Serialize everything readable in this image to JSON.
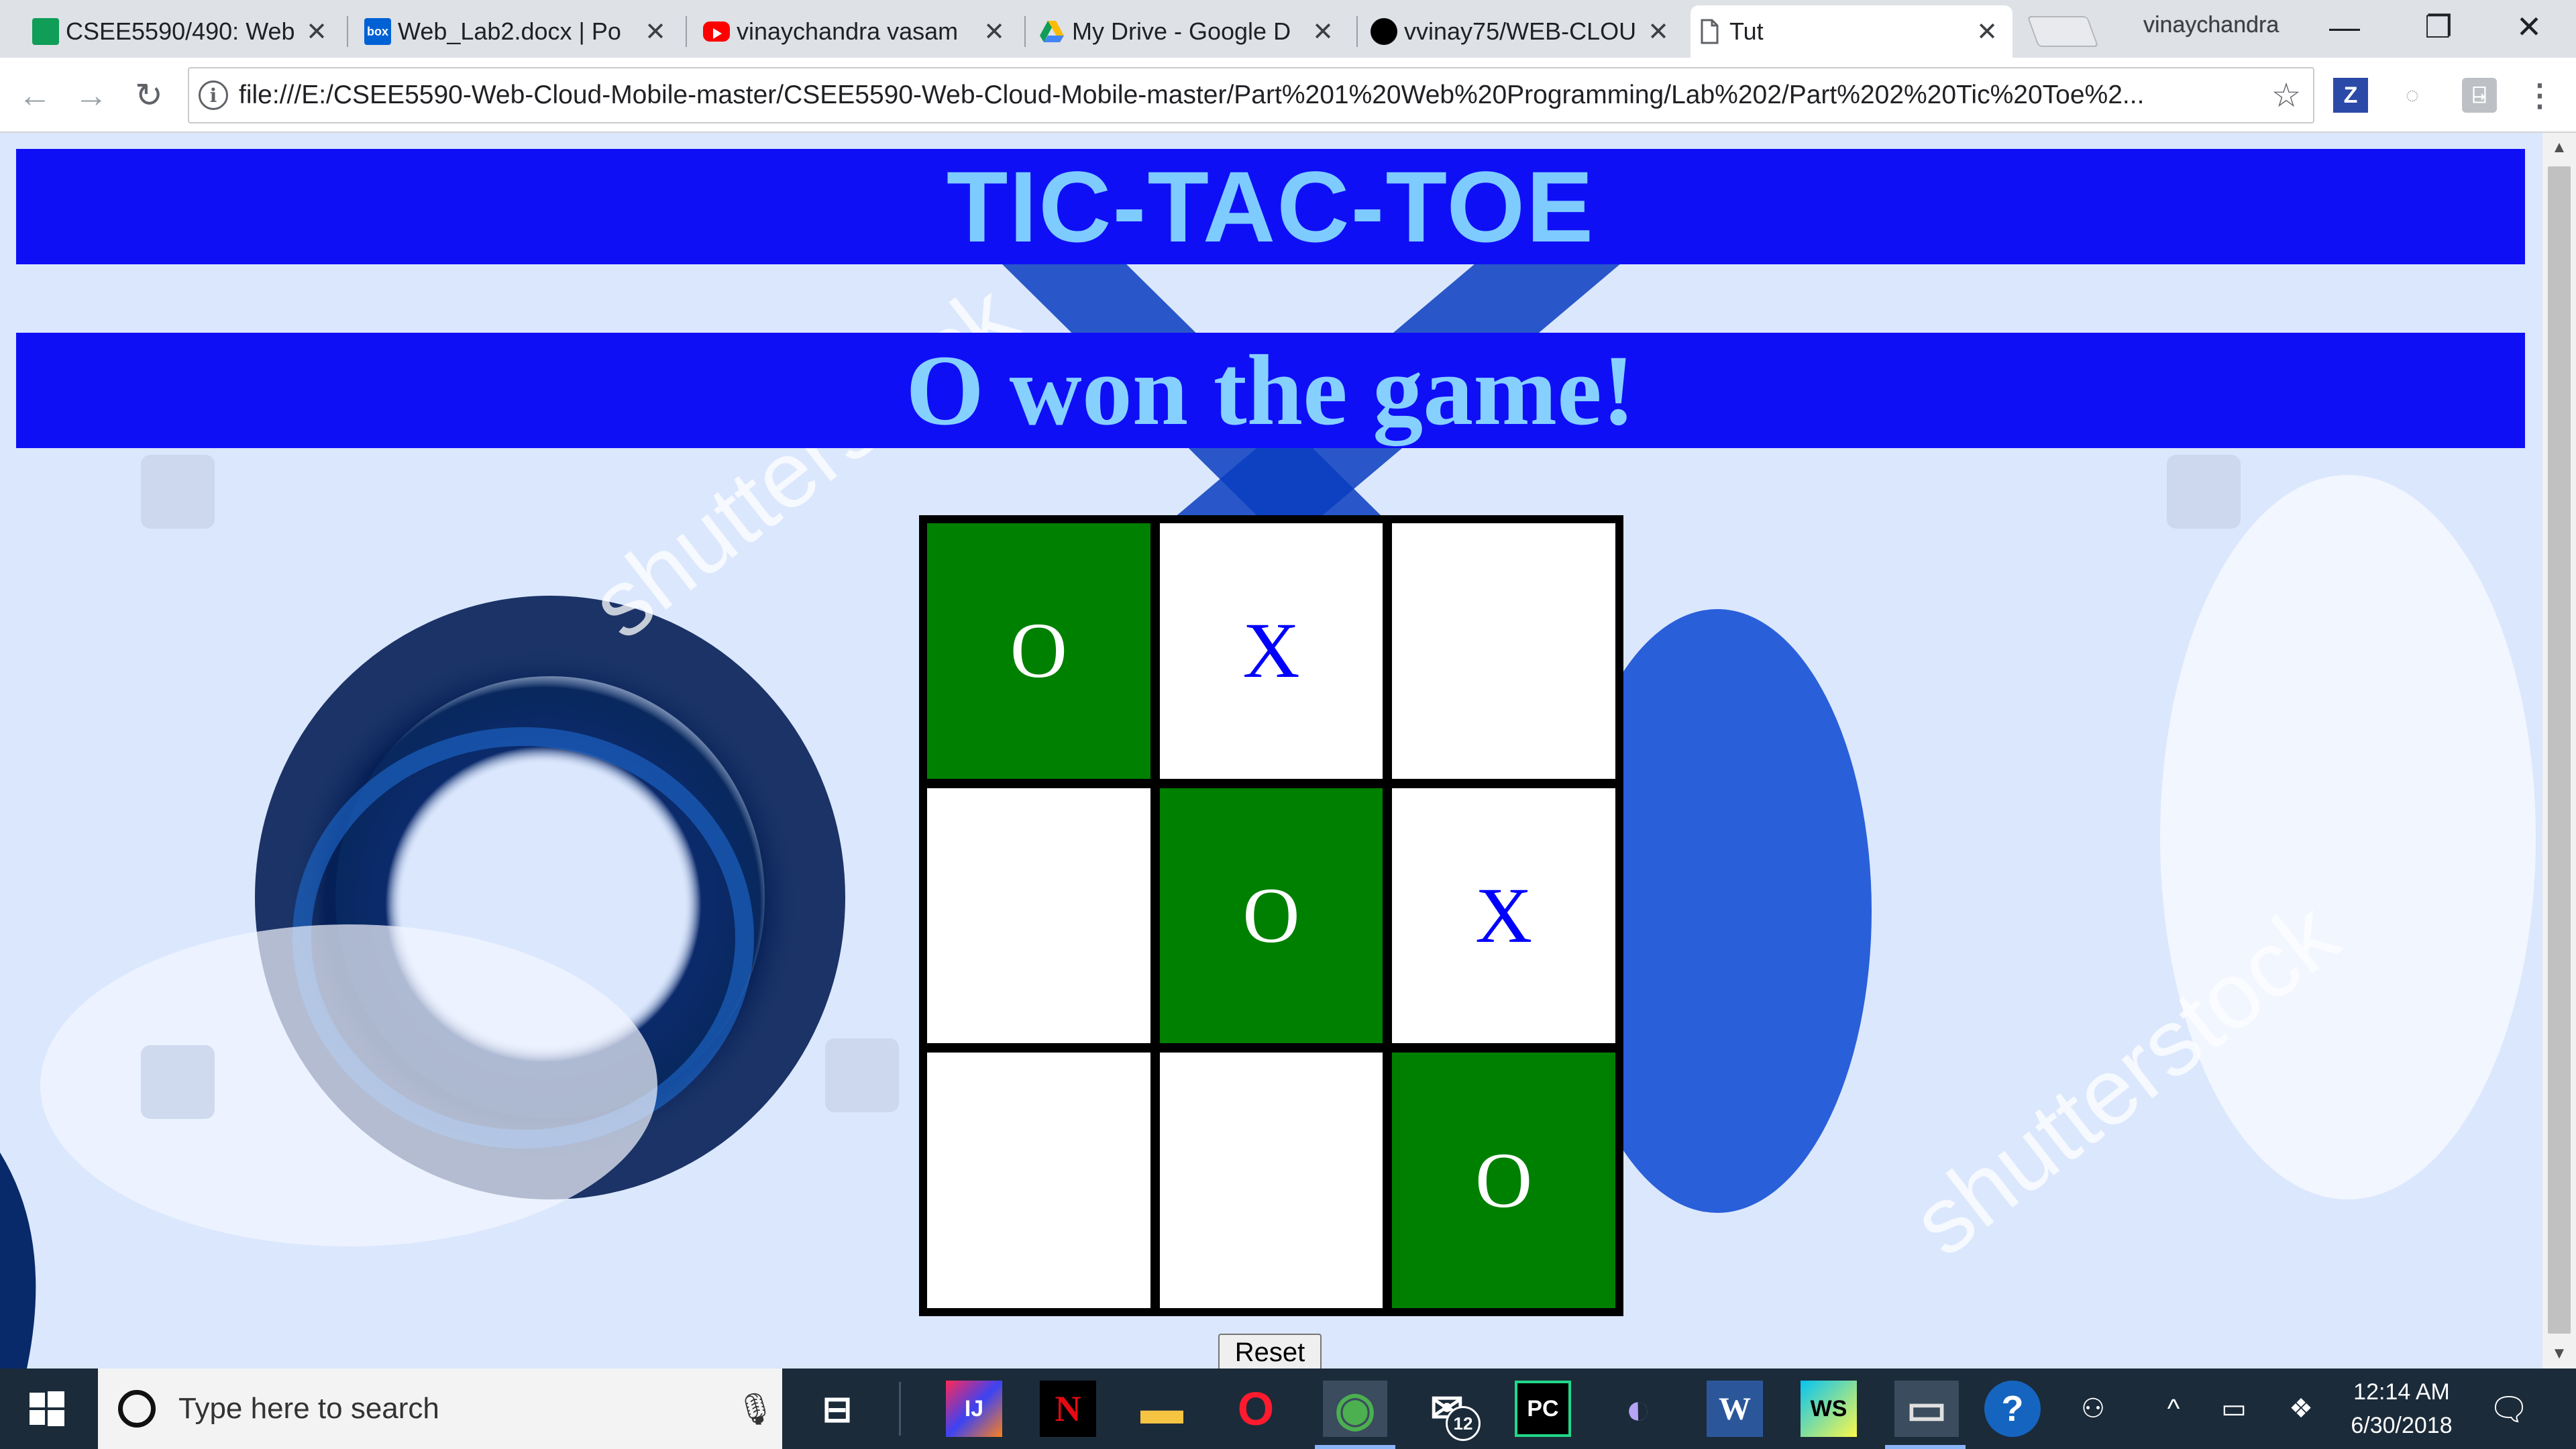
{
  "browser": {
    "tabs": [
      {
        "label": "CSEE5590/490: Web",
        "icon": "google-sheets-icon",
        "color": "#0f9d58"
      },
      {
        "label": "Web_Lab2.docx | Po",
        "icon": "box-icon",
        "color": "#0061d5"
      },
      {
        "label": "vinaychandra vasam",
        "icon": "youtube-icon",
        "color": "#ff0000"
      },
      {
        "label": "My Drive - Google D",
        "icon": "google-drive-icon",
        "color": "#fbbc04"
      },
      {
        "label": "vvinay75/WEB-CLOU",
        "icon": "github-icon",
        "color": "#000000"
      },
      {
        "label": "Tut",
        "icon": "page-icon",
        "color": "#5f6368",
        "active": true
      }
    ],
    "tab_close_glyph": "✕",
    "profile_name": "vinaychandra",
    "window_controls": {
      "minimize": "—",
      "restore": "❐",
      "close": "✕"
    },
    "nav": {
      "back": "←",
      "forward": "→",
      "reload": "↻"
    },
    "url": "file:///E:/CSEE5590-Web-Cloud-Mobile-master/CSEE5590-Web-Cloud-Mobile-master/Part%201%20Web%20Programming/Lab%202/Part%202%20Tic%20Toe%2...",
    "bookmark_glyph": "☆",
    "extensions": [
      {
        "icon": "zotero-icon",
        "glyph": "Z"
      },
      {
        "icon": "extension-circle-icon",
        "glyph": "◌"
      },
      {
        "icon": "extension-puzzle-icon",
        "glyph": "⍈"
      },
      {
        "icon": "menu-kebab-icon",
        "glyph": "⋮"
      }
    ]
  },
  "game": {
    "title": "TIC-TAC-TOE",
    "status": "O won the game!",
    "board": [
      {
        "mark": "O",
        "winning": true
      },
      {
        "mark": "X",
        "winning": false
      },
      {
        "mark": "",
        "winning": false
      },
      {
        "mark": "",
        "winning": false
      },
      {
        "mark": "O",
        "winning": true
      },
      {
        "mark": "X",
        "winning": false
      },
      {
        "mark": "",
        "winning": false
      },
      {
        "mark": "",
        "winning": false
      },
      {
        "mark": "O",
        "winning": true
      }
    ],
    "reset_label": "Reset",
    "colors": {
      "banner": "#0f0ff6",
      "title_text": "#7ecbff",
      "win_cell": "#008000",
      "x_mark": "#0000ff"
    },
    "background_watermark": "shutterstock"
  },
  "taskbar": {
    "search_placeholder": "Type here to search",
    "apps": [
      {
        "icon": "task-view-icon",
        "glyph": "⊟"
      },
      {
        "icon": "intellij-icon",
        "glyph": "IJ"
      },
      {
        "icon": "netflix-icon",
        "glyph": "N"
      },
      {
        "icon": "file-explorer-icon",
        "glyph": "▬"
      },
      {
        "icon": "opera-icon",
        "glyph": "O"
      },
      {
        "icon": "chrome-icon",
        "glyph": "◉"
      },
      {
        "icon": "mail-icon",
        "glyph": "✉",
        "badge": "12"
      },
      {
        "icon": "pycharm-icon",
        "glyph": "PC"
      },
      {
        "icon": "app-swirl-icon",
        "glyph": "◐"
      },
      {
        "icon": "word-icon",
        "glyph": "W"
      },
      {
        "icon": "webstorm-icon",
        "glyph": "WS"
      },
      {
        "icon": "desktop-app-icon",
        "glyph": "▭"
      },
      {
        "icon": "help-icon",
        "glyph": "?"
      }
    ],
    "tray": [
      {
        "icon": "people-icon",
        "glyph": "⚇"
      },
      {
        "icon": "chevron-up-icon",
        "glyph": "^"
      },
      {
        "icon": "battery-icon",
        "glyph": "▭"
      },
      {
        "icon": "dropbox-icon",
        "glyph": "❖"
      }
    ],
    "time": "12:14 AM",
    "date": "6/30/2018",
    "notification_glyph": "🗨"
  }
}
